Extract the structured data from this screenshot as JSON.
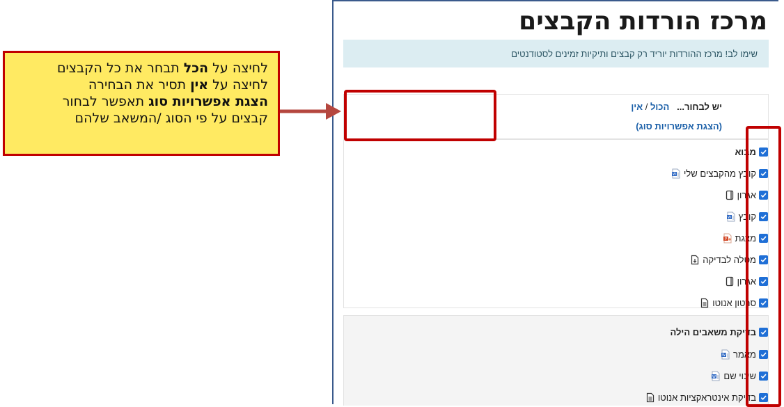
{
  "page": {
    "title": "מרכז הורדות הקבצים",
    "notice": "שימו לב! מרכז ההורדות יוריד רק קבצים ותיקיות זמינים לסטודנטים"
  },
  "selection": {
    "label": "יש לבחור...",
    "all_link": "הכול",
    "separator": "/",
    "none_link": "אין",
    "type_options_link": "(הצגת אפשרויות סוג)"
  },
  "sections": [
    {
      "name": "מבוא",
      "checked": true,
      "items": [
        {
          "label": "קובץ מהקבצים שלי",
          "icon": "word-doc-icon",
          "checked": true
        },
        {
          "label": "אגרון",
          "icon": "folder-icon",
          "checked": true
        },
        {
          "label": "קובץ",
          "icon": "word-doc-icon",
          "checked": true
        },
        {
          "label": "מצגת",
          "icon": "powerpoint-icon",
          "checked": true
        },
        {
          "label": "מטלה לבדיקה",
          "icon": "assignment-icon",
          "checked": true
        },
        {
          "label": "אגרון",
          "icon": "folder-icon",
          "checked": true
        },
        {
          "label": "סרטון אנוטו",
          "icon": "page-icon",
          "checked": true
        }
      ]
    },
    {
      "name": "בדיקת משאבים הילה",
      "checked": true,
      "items": [
        {
          "label": "מאמר",
          "icon": "word-doc-icon",
          "checked": true
        },
        {
          "label": "שינוי שם",
          "icon": "word-doc-icon",
          "checked": true
        },
        {
          "label": "בדיקת אינטראקציות אנוטו",
          "icon": "page-icon",
          "checked": true
        }
      ]
    }
  ],
  "callout": {
    "line1": {
      "pre": "לחיצה על ",
      "bold": "הכל",
      "post": " תבחר את כל הקבצים"
    },
    "line2": {
      "pre": "לחיצה על ",
      "bold": "אין",
      "post": " תסיר את הבחירה"
    },
    "line3": {
      "pre": "",
      "bold": "הצגת אפשרויות סוג",
      "post": " תאפשר לבחור"
    },
    "line4": {
      "pre": "קבצים על פי הסוג /המשאב שלהם",
      "bold": "",
      "post": ""
    }
  },
  "colors": {
    "accent_red": "#c00000",
    "callout_yellow": "#ffea62",
    "link_blue": "#1a5fa8",
    "checkbox_blue": "#1f6fd6",
    "notice_bg": "#dcedf2"
  }
}
